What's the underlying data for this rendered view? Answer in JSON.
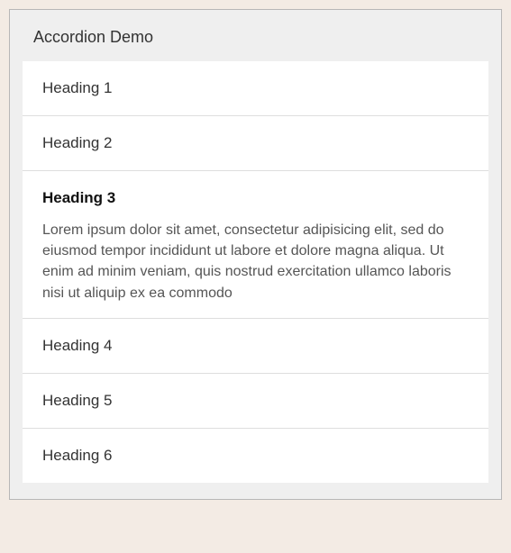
{
  "panel": {
    "title": "Accordion Demo"
  },
  "accordion": {
    "expanded_index": 2,
    "items": [
      {
        "heading": "Heading 1",
        "content": ""
      },
      {
        "heading": "Heading 2",
        "content": ""
      },
      {
        "heading": "Heading 3",
        "content": "Lorem ipsum dolor sit amet, consectetur adipisicing elit, sed do eiusmod tempor incididunt ut labore et dolore magna aliqua. Ut enim ad minim veniam, quis nostrud exercitation ullamco laboris nisi ut aliquip ex ea commodo"
      },
      {
        "heading": "Heading 4",
        "content": ""
      },
      {
        "heading": "Heading 5",
        "content": ""
      },
      {
        "heading": "Heading 6",
        "content": ""
      }
    ]
  }
}
